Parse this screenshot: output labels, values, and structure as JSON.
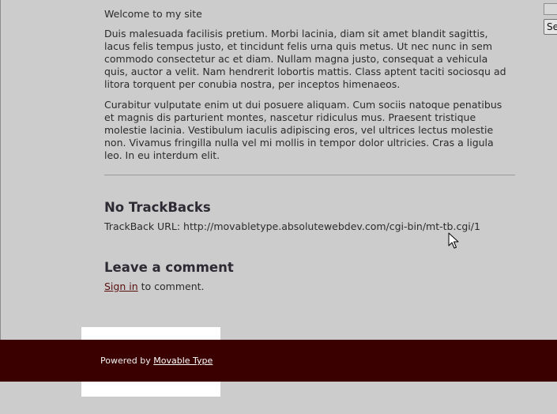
{
  "main": {
    "welcome": "Welcome to my site",
    "paragraph_1": "Duis malesuada facilisis pretium. Morbi lacinia, diam sit amet blandit sagittis, lacus felis tempus justo, et tincidunt felis urna quis metus. Ut nec nunc in sem commodo consectetur ac et diam. Nullam magna justo, consequat a vehicula quis, auctor a velit. Nam hendrerit lobortis mattis. Class aptent taciti sociosqu ad litora torquent per conubia nostra, per inceptos himenaeos.",
    "paragraph_2": "Curabitur vulputate enim ut dui posuere aliquam. Cum sociis natoque penatibus et magnis dis parturient montes, nascetur ridiculus mus. Praesent tristique molestie lacinia. Vestibulum iaculis adipiscing eros, vel ultrices lectus molestie non. Vivamus fringilla nulla vel mi mollis in tempor dolor ultricies. Cras a ligula leo. In eu interdum elit."
  },
  "trackbacks": {
    "heading": "No TrackBacks",
    "url_label": "TrackBack URL:",
    "url": "http://movabletype.absolutewebdev.com/cgi-bin/mt-tb.cgi/1"
  },
  "comments": {
    "heading": "Leave a comment",
    "sign_in_label": "Sign in",
    "sign_in_suffix": "to comment."
  },
  "search": {
    "button_label": "Se"
  },
  "footer": {
    "powered_prefix": "Powered by",
    "powered_link": "Movable Type"
  },
  "colors": {
    "page_background": "#cccccc",
    "footer_background": "#3a0000",
    "link": "#5a0f0f",
    "heading": "#2e2a33"
  },
  "icons": {
    "cursor": "mouse-pointer-icon"
  }
}
